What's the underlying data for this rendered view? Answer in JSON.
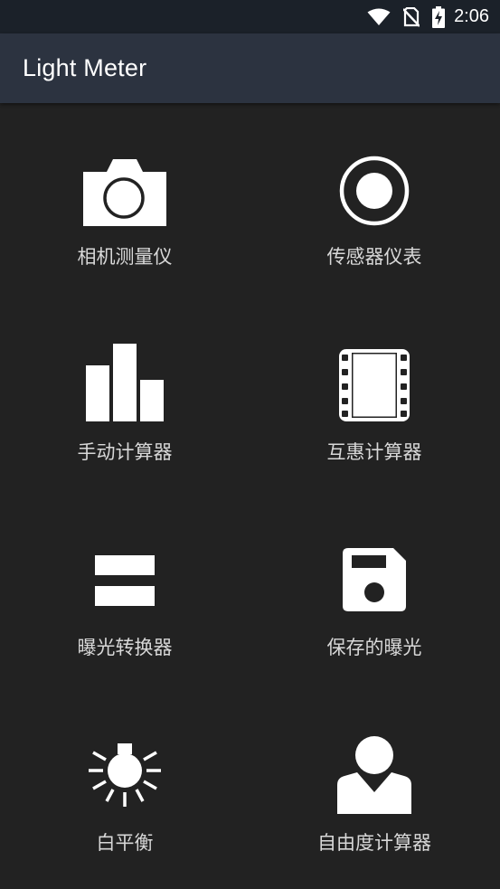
{
  "status_bar": {
    "time": "2:06",
    "icons": [
      "wifi-icon",
      "no-sim-icon",
      "battery-charging-icon"
    ]
  },
  "app_bar": {
    "title": "Light Meter"
  },
  "menu": [
    {
      "label": "相机测量仪",
      "icon": "camera-icon"
    },
    {
      "label": "传感器仪表",
      "icon": "record-circle-icon"
    },
    {
      "label": "手动计算器",
      "icon": "bar-chart-icon"
    },
    {
      "label": "互惠计算器",
      "icon": "film-strip-icon"
    },
    {
      "label": "曝光转换器",
      "icon": "equal-icon"
    },
    {
      "label": "保存的曝光",
      "icon": "floppy-disk-icon"
    },
    {
      "label": "白平衡",
      "icon": "bulb-icon"
    },
    {
      "label": "自由度计算器",
      "icon": "person-icon"
    }
  ],
  "colors": {
    "background": "#222222",
    "app_bar": "#2c3340",
    "status_bar": "#1b2129",
    "label": "#d8d8d8",
    "icon": "#ffffff"
  }
}
